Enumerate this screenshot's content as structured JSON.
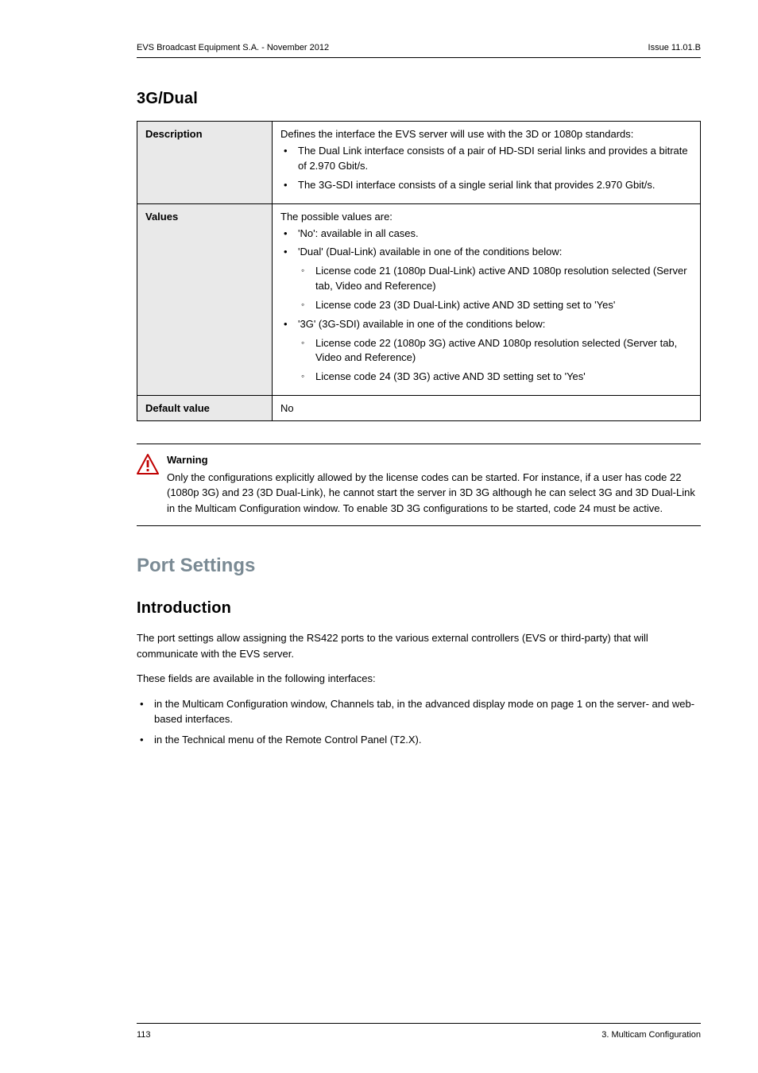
{
  "header": {
    "left": "EVS Broadcast Equipment S.A. - November 2012",
    "right": "Issue 11.01.B"
  },
  "section_3g": {
    "title": "3G/Dual",
    "rows": {
      "description": {
        "label": "Description",
        "intro": "Defines the interface the EVS server will use with the 3D or 1080p standards:",
        "b1": "The Dual Link interface consists of a pair of HD-SDI serial links and provides a bitrate of 2.970 Gbit/s.",
        "b2": "The 3G-SDI interface consists of a single serial link that provides 2.970 Gbit/s."
      },
      "values": {
        "label": "Values",
        "intro": "The possible values are:",
        "b1": "'No': available in all cases.",
        "b2": "'Dual' (Dual-Link) available in one of the conditions below:",
        "b2s1": "License code 21 (1080p Dual-Link) active AND 1080p resolution selected (Server tab, Video and Reference)",
        "b2s2": "License code 23 (3D Dual-Link) active AND 3D setting set to 'Yes'",
        "b3": "'3G' (3G-SDI) available in one of the conditions below:",
        "b3s1": "License code 22 (1080p 3G) active AND 1080p resolution selected (Server tab, Video and Reference)",
        "b3s2": "License code 24 (3D 3G) active AND 3D setting set to 'Yes'"
      },
      "default": {
        "label": "Default value",
        "value": "No"
      }
    }
  },
  "warning": {
    "title": "Warning",
    "text": "Only the configurations explicitly allowed by the license codes can be started. For instance, if a user has code 22 (1080p 3G) and 23 (3D Dual-Link), he cannot start the server in 3D 3G although he can select 3G and 3D Dual-Link in the Multicam Configuration window. To enable 3D 3G configurations to be started, code 24 must be active."
  },
  "port": {
    "title": "Port Settings",
    "intro_title": "Introduction",
    "p1": "The port settings allow assigning the RS422 ports to the various external controllers (EVS or third-party) that will communicate with the EVS server.",
    "p2": "These fields are available in the following interfaces:",
    "b1": "in the Multicam Configuration window, Channels tab, in the advanced display mode on page 1 on the server- and web-based interfaces.",
    "b2": "in the Technical menu of the Remote Control Panel (T2.X)."
  },
  "footer": {
    "left": "113",
    "right": "3. Multicam Configuration"
  }
}
